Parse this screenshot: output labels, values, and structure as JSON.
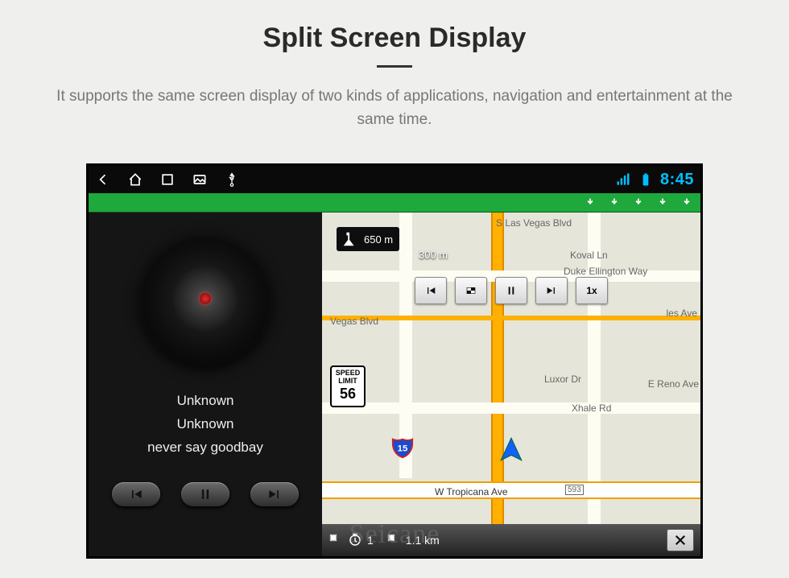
{
  "page": {
    "title": "Split Screen Display",
    "subtitle": "It supports the same screen display of two kinds of applications, navigation and entertainment at the same time."
  },
  "statusbar": {
    "clock": "8:45"
  },
  "player": {
    "artist": "Unknown",
    "album": "Unknown",
    "track": "never say goodbay"
  },
  "nav": {
    "distance_primary": "650 m",
    "distance_secondary": "300 m",
    "speed_limit_label_top": "SPEED",
    "speed_limit_label_mid": "LIMIT",
    "speed_limit_value": "56",
    "speedx_label": "1x",
    "interstate": "15",
    "bottom_time": "1",
    "bottom_dist": "1.1 km",
    "roads": {
      "s_las_vegas_blvd": "S Las Vegas Blvd",
      "koval_ln": "Koval Ln",
      "duke_ellington": "Duke Ellington Way",
      "vegas_blvd": "Vegas Blvd",
      "e_reno_ave": "E Reno Ave",
      "luxor_dr": "Luxor Dr",
      "xhale_rd": "Xhale Rd",
      "w_tropicana": "W Tropicana Ave",
      "w_tropicana_tag": "593",
      "les_ave": "les Ave"
    }
  },
  "watermark": "Seicane"
}
